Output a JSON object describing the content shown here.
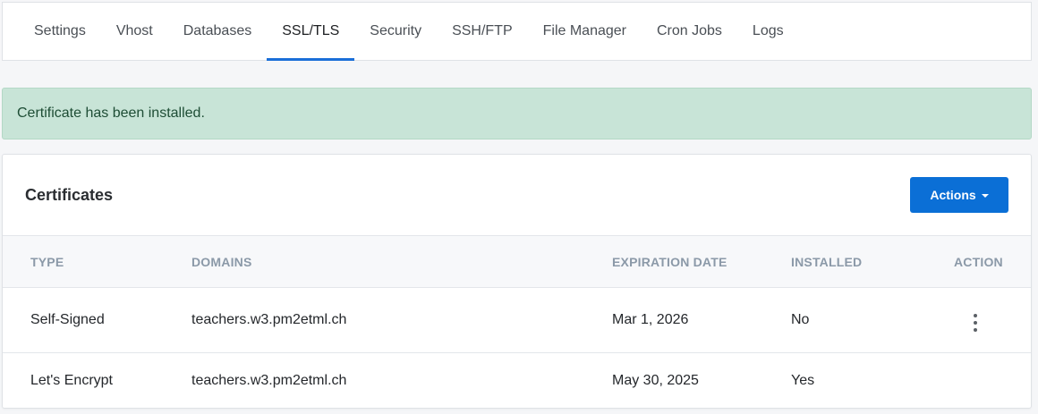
{
  "tabs": [
    {
      "label": "Settings",
      "active": false
    },
    {
      "label": "Vhost",
      "active": false
    },
    {
      "label": "Databases",
      "active": false
    },
    {
      "label": "SSL/TLS",
      "active": true
    },
    {
      "label": "Security",
      "active": false
    },
    {
      "label": "SSH/FTP",
      "active": false
    },
    {
      "label": "File Manager",
      "active": false
    },
    {
      "label": "Cron Jobs",
      "active": false
    },
    {
      "label": "Logs",
      "active": false
    }
  ],
  "alert": {
    "message": "Certificate has been installed.",
    "color": "#c8e4d7"
  },
  "certificates": {
    "title": "Certificates",
    "actions_label": "Actions",
    "columns": {
      "type": "TYPE",
      "domains": "DOMAINS",
      "expiration": "EXPIRATION DATE",
      "installed": "INSTALLED",
      "action": "ACTION"
    },
    "rows": [
      {
        "type": "Self-Signed",
        "domains": "teachers.w3.pm2etml.ch",
        "expiration": "Mar 1, 2026",
        "installed": "No",
        "has_menu": true
      },
      {
        "type": "Let's Encrypt",
        "domains": "teachers.w3.pm2etml.ch",
        "expiration": "May 30, 2025",
        "installed": "Yes",
        "has_menu": false
      }
    ]
  },
  "colors": {
    "accent": "#0b6fd6",
    "active_tab_underline": "#1a6ed8"
  }
}
